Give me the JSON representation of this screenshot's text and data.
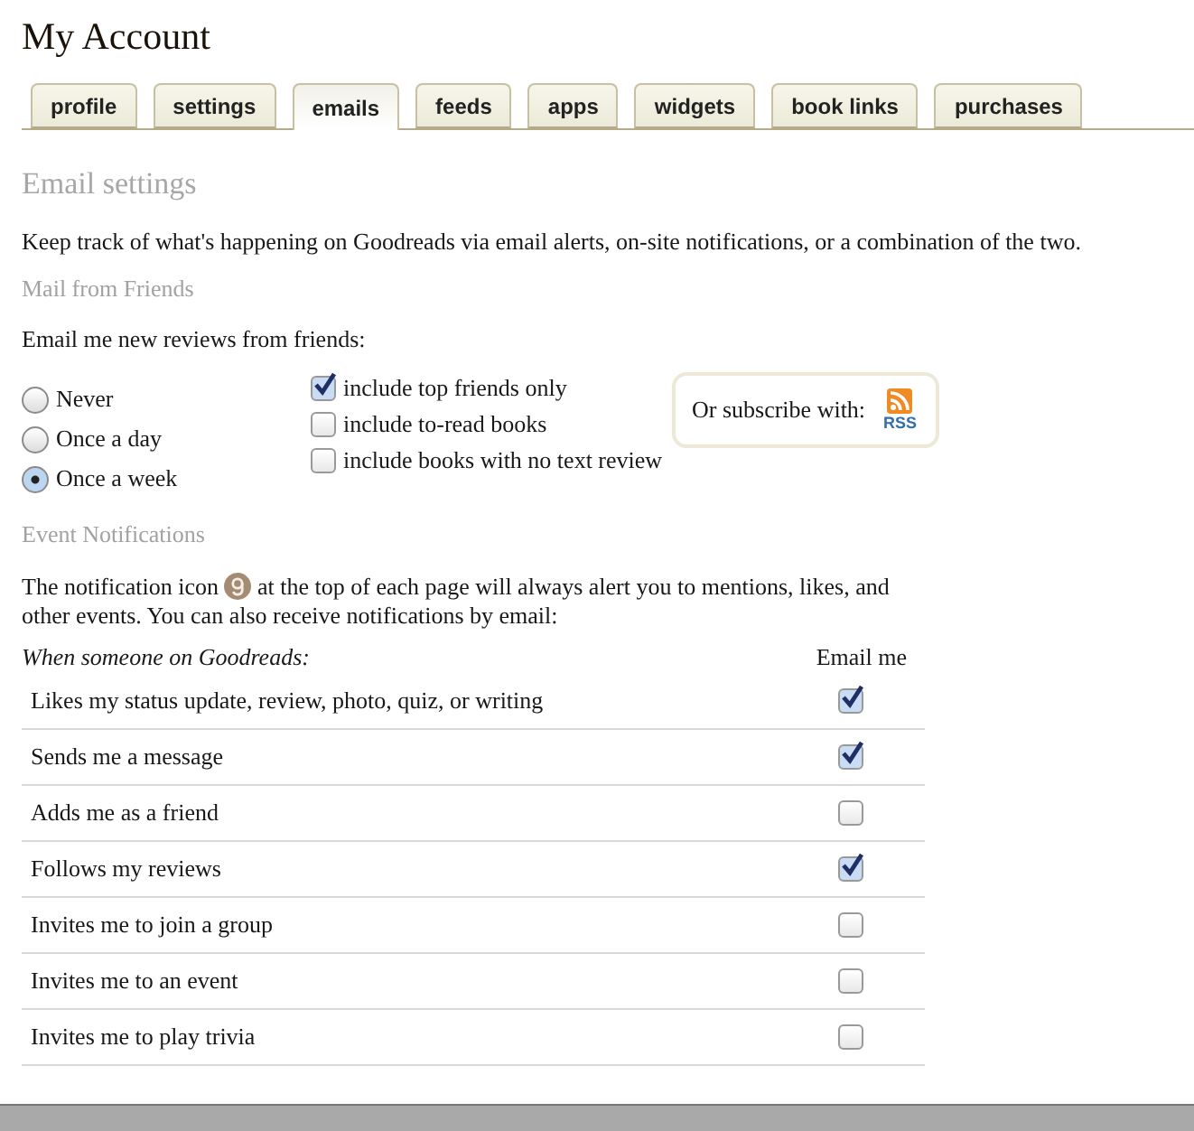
{
  "page_title": "My Account",
  "tabs": [
    {
      "label": "profile",
      "selected": false
    },
    {
      "label": "settings",
      "selected": false
    },
    {
      "label": "emails",
      "selected": true
    },
    {
      "label": "feeds",
      "selected": false
    },
    {
      "label": "apps",
      "selected": false
    },
    {
      "label": "widgets",
      "selected": false
    },
    {
      "label": "book links",
      "selected": false
    },
    {
      "label": "purchases",
      "selected": false
    }
  ],
  "section_title": "Email settings",
  "intro": "Keep track of what's happening on Goodreads via email alerts, on-site notifications, or a combination of the two.",
  "mail_from_friends": {
    "heading": "Mail from Friends",
    "prompt": "Email me new reviews from friends:",
    "frequency": [
      {
        "label": "Never",
        "selected": false
      },
      {
        "label": "Once a day",
        "selected": false
      },
      {
        "label": "Once a week",
        "selected": true
      }
    ],
    "options": [
      {
        "label": "include top friends only",
        "checked": true
      },
      {
        "label": "include to-read books",
        "checked": false
      },
      {
        "label": "include books with no text review",
        "checked": false
      }
    ],
    "subscribe": {
      "label": "Or subscribe with:",
      "rss": "RSS"
    }
  },
  "event_notifications": {
    "heading": "Event Notifications",
    "text_before": "The notification icon",
    "text_after": "at the top of each page will always alert you to mentions, likes, and other events. You can also receive notifications by email:",
    "columns": [
      "When someone on Goodreads:",
      "Email me"
    ],
    "rows": [
      {
        "label": "Likes my status update, review, photo, quiz, or writing",
        "checked": true
      },
      {
        "label": "Sends me a message",
        "checked": true
      },
      {
        "label": "Adds me as a friend",
        "checked": false
      },
      {
        "label": "Follows my reviews",
        "checked": true
      },
      {
        "label": "Invites me to join a group",
        "checked": false
      },
      {
        "label": "Invites me to an event",
        "checked": false
      },
      {
        "label": "Invites me to play trivia",
        "checked": false
      }
    ]
  }
}
